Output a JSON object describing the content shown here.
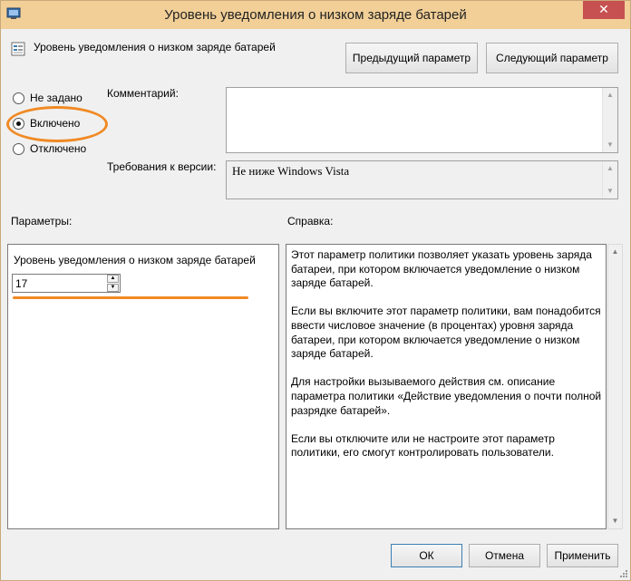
{
  "window": {
    "title": "Уровень уведомления о низком заряде батарей",
    "close_glyph": "✕"
  },
  "policy": {
    "name": "Уровень уведомления о низком заряде батарей"
  },
  "nav": {
    "prev_label": "Предыдущий параметр",
    "next_label": "Следующий параметр"
  },
  "state": {
    "options": [
      {
        "label": "Не задано",
        "checked": false
      },
      {
        "label": "Включено",
        "checked": true
      },
      {
        "label": "Отключено",
        "checked": false
      }
    ]
  },
  "comment": {
    "label": "Комментарий:",
    "value": ""
  },
  "requirements": {
    "label": "Требования к версии:",
    "value": "Не ниже Windows Vista"
  },
  "params": {
    "label": "Параметры:",
    "field_label": "Уровень уведомления о низком заряде батарей",
    "field_value": "17"
  },
  "help": {
    "label": "Справка:",
    "paragraphs": [
      "Этот параметр политики позволяет указать уровень заряда батареи, при котором включается уведомление о низком заряде батарей.",
      "Если вы включите этот параметр политики, вам понадобится ввести числовое значение (в процентах) уровня заряда батареи, при котором включается уведомление о низком заряде батарей.",
      "Для настройки вызываемого действия см. описание параметра политики «Действие уведомления о почти полной разрядке батарей».",
      "Если вы отключите или не настроите этот параметр политики, его смогут контролировать пользователи."
    ]
  },
  "buttons": {
    "ok": "ОК",
    "cancel": "Отмена",
    "apply": "Применить"
  },
  "colors": {
    "titlebar": "#f1cf97",
    "close": "#c75050",
    "highlight": "#f08a24"
  }
}
